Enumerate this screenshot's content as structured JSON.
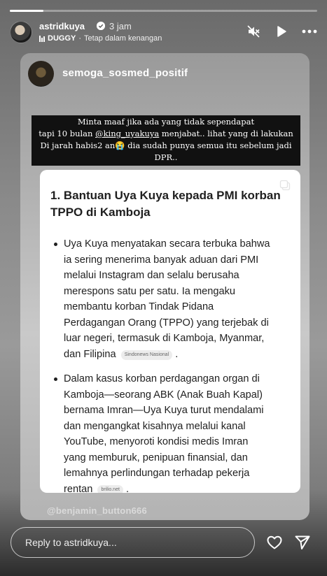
{
  "story": {
    "progress": 0.11,
    "username": "astridkuya",
    "timestamp": "3 jam",
    "music_artist": "DUGGY",
    "music_separator": "·",
    "music_title": "Tetap dalam kenangan"
  },
  "icons": {
    "verified": "verified-badge-icon",
    "mute": "speaker-muted-icon",
    "play": "play-icon",
    "more": "more-horizontal-icon",
    "copy": "copy-icon",
    "heart": "heart-icon",
    "send": "send-icon"
  },
  "repost": {
    "username": "semoga_sosmed_positif"
  },
  "caption": {
    "line1": "Minta maaf jika ada yang tidak sependapat",
    "line2_before": "tapi 10 bulan ",
    "mention": "@king_uyakuya",
    "line2_after": "  menjabat.. lihat yang di lakukan",
    "line3_before": "Di jarah habis2 an",
    "emoji": "😭",
    "line3_after": " dia sudah punya semua itu sebelum jadi",
    "line4": "DPR.."
  },
  "article": {
    "title_lines": [
      "1. Bantuan Uya Kuya kepada PMI korban",
      "TPPO di Kamboja"
    ],
    "bullets": [
      {
        "lines": [
          "Uya Kuya menyatakan secara terbuka bahwa",
          "ia sering menerima banyak aduan dari PMI",
          "melalui Instagram dan selalu berusaha",
          "merespons satu per satu. Ia mengaku",
          "membantu korban Tindak Pidana",
          "Perdagangan Orang (TPPO) yang terjebak di",
          "luar negeri, termasuk di Kamboja, Myanmar,"
        ],
        "last_line": "dan Filipina",
        "source": "Sindonews Nasional",
        "end": "."
      },
      {
        "lines": [
          "Dalam kasus korban perdagangan organ di",
          "Kamboja—seorang ABK (Anak Buah Kapal)",
          "bernama Imran—Uya Kuya turut mendalami",
          "dan mengangkat kisahnya melalui kanal",
          "YouTube, menyoroti kondisi medis Imran",
          "yang memburuk, penipuan finansial, dan",
          "lemahnya perlindungan terhadap pekerja"
        ],
        "last_line": "rentan",
        "source": "brilio.net",
        "end": "."
      }
    ]
  },
  "watermark": "@benjamin_button666",
  "footer": {
    "reply_placeholder": "Reply to astridkuya..."
  },
  "colors": {
    "caption_bg": "#111111",
    "article_bg": "#ffffff",
    "text_dark": "#1f1f1f"
  }
}
